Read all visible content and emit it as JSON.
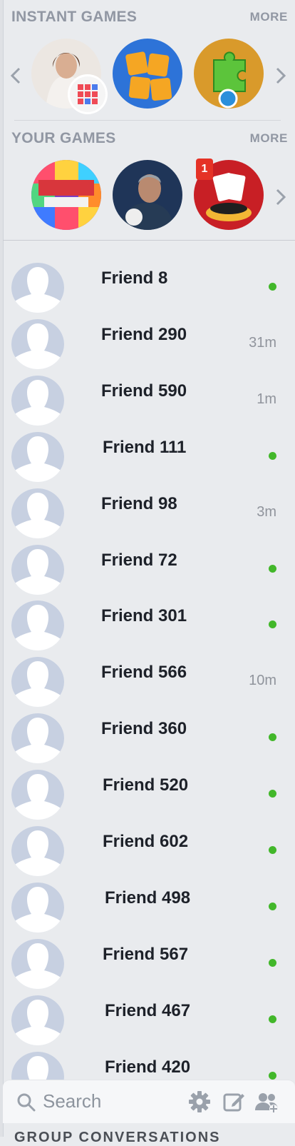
{
  "instant_games": {
    "title": "INSTANT GAMES",
    "more_label": "MORE"
  },
  "your_games": {
    "title": "YOUR GAMES",
    "more_label": "MORE",
    "poker_notification_count": "1"
  },
  "colors": {
    "online": "#42b72a",
    "section_header": "#9197a3",
    "name_text": "#1d2129",
    "time_text": "#90949c",
    "notification": "#e53226"
  },
  "friends": [
    {
      "name": "Friend 8",
      "status": "online"
    },
    {
      "name": "Friend 290",
      "time": "31m"
    },
    {
      "name": "Friend 590",
      "time": "1m"
    },
    {
      "name": "Friend 111",
      "status": "online"
    },
    {
      "name": "Friend 98",
      "time": "3m"
    },
    {
      "name": "Friend 72",
      "status": "online"
    },
    {
      "name": "Friend 301",
      "status": "online"
    },
    {
      "name": "Friend 566",
      "time": "10m"
    },
    {
      "name": "Friend 360",
      "status": "online"
    },
    {
      "name": "Friend 520",
      "status": "online"
    },
    {
      "name": "Friend 602",
      "status": "online"
    },
    {
      "name": "Friend 498",
      "status": "online"
    },
    {
      "name": "Friend 567",
      "status": "online"
    },
    {
      "name": "Friend 467",
      "status": "online"
    },
    {
      "name": "Friend 420",
      "status": "online"
    }
  ],
  "search": {
    "placeholder": "Search"
  },
  "footer": {
    "peek_text": "GROUP CONVERSATIONS"
  }
}
